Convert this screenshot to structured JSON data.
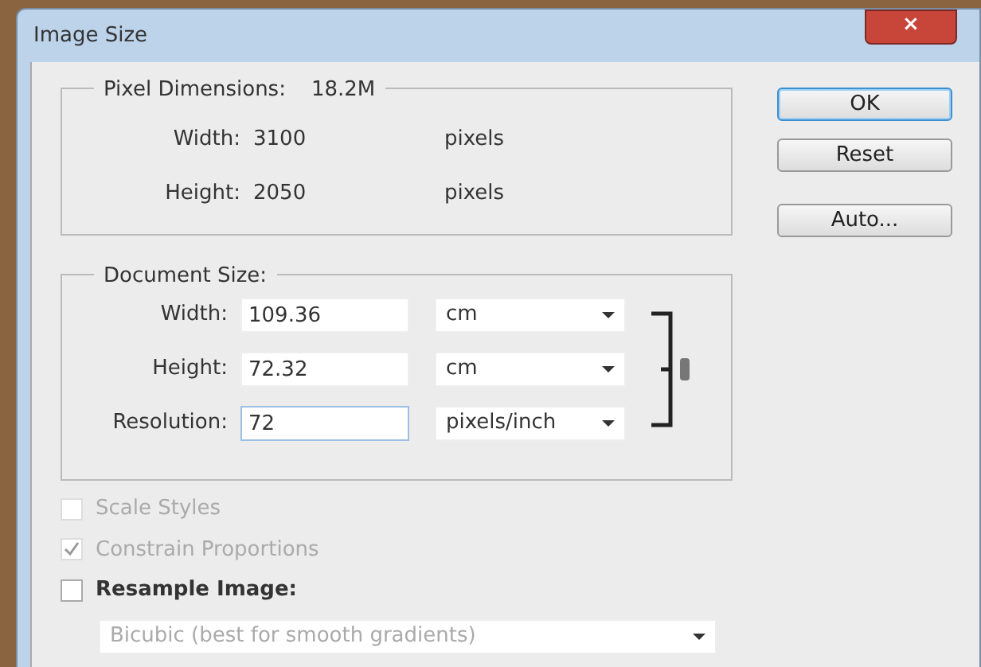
{
  "window": {
    "title": "Image Size",
    "close": "×"
  },
  "pixel_dimensions": {
    "legend": "Pixel Dimensions:",
    "total": "18.2M",
    "rows": [
      {
        "label": "Width:",
        "value": "3100",
        "unit": "pixels"
      },
      {
        "label": "Height:",
        "value": "2050",
        "unit": "pixels"
      }
    ]
  },
  "buttons": [
    {
      "label": "OK",
      "default": true
    },
    {
      "label": "Reset",
      "default": false
    },
    {
      "label": "Auto...",
      "default": false
    }
  ],
  "document_size": {
    "legend": "Document Size:",
    "rows": [
      {
        "label": "Width:",
        "value": "109.36",
        "unit": "cm",
        "focused": false
      },
      {
        "label": "Height:",
        "value": "72.32",
        "unit": "cm",
        "focused": false
      },
      {
        "label": "Resolution:",
        "value": "72",
        "unit": "pixels/inch",
        "focused": true
      }
    ]
  },
  "options": [
    {
      "label": "Scale Styles",
      "checked": false,
      "disabled": true
    },
    {
      "label": "Constrain Proportions",
      "checked": true,
      "disabled": true
    },
    {
      "label": "Resample Image:",
      "checked": false,
      "disabled": false
    }
  ],
  "resample_method": {
    "value": "Bicubic (best for smooth gradients)",
    "disabled": true
  }
}
